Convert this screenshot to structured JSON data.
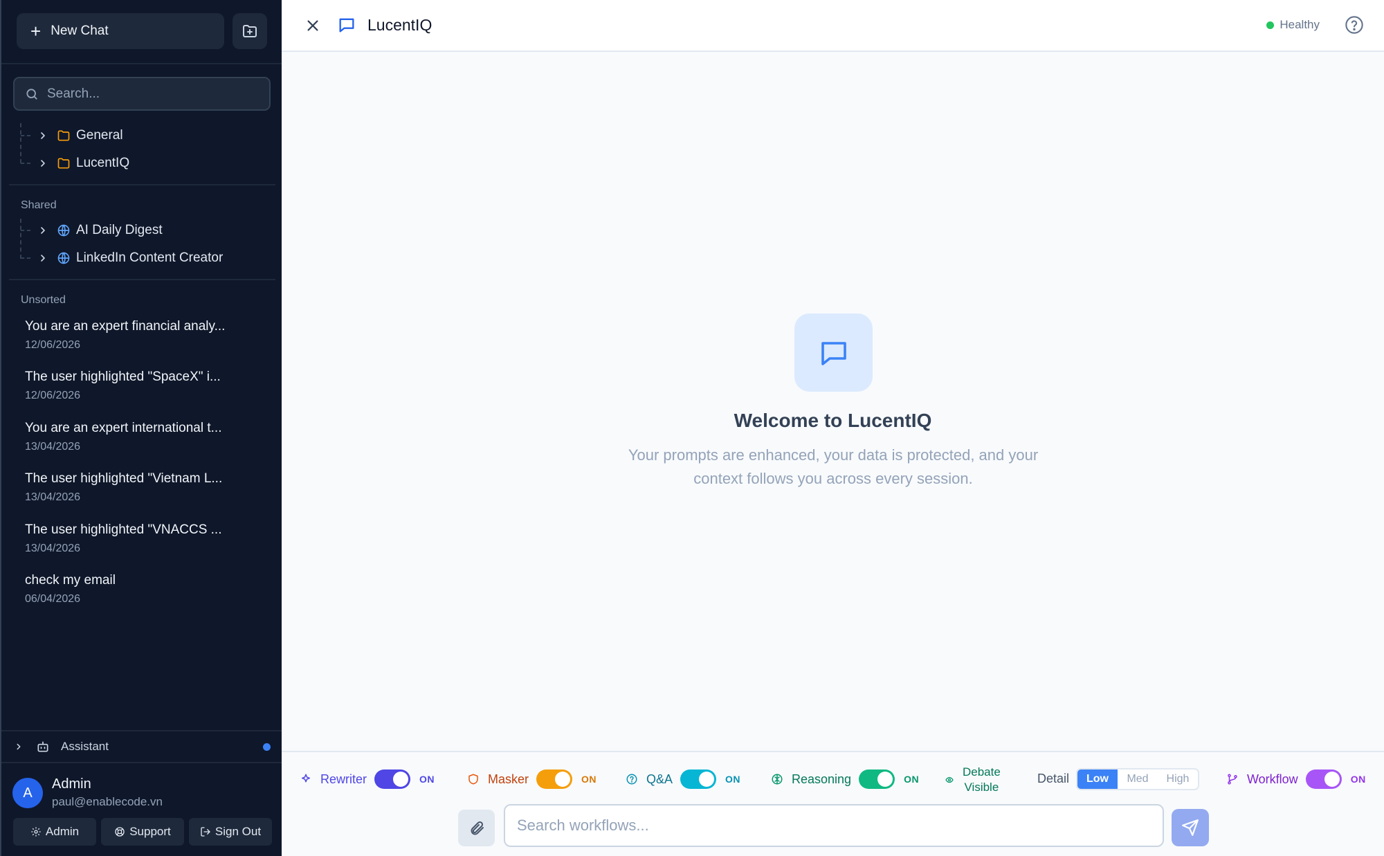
{
  "app": {
    "title": "LucentIQ"
  },
  "sidebar": {
    "new_chat_label": "New Chat",
    "new_chat_icon": "plus-icon",
    "new_folder_icon": "folder-plus-icon",
    "search": {
      "placeholder": "Search...",
      "value": ""
    },
    "folders": [
      {
        "label": "General",
        "icon": "folder-icon"
      },
      {
        "label": "LucentIQ",
        "icon": "folder-icon"
      }
    ],
    "shared_label": "Shared",
    "shared": [
      {
        "label": "AI Daily Digest",
        "icon": "globe-icon"
      },
      {
        "label": "LinkedIn Content Creator",
        "icon": "globe-icon"
      }
    ],
    "unsorted_label": "Unsorted",
    "chats": [
      {
        "title": "You are an expert financial analy...",
        "date": "12/06/2026"
      },
      {
        "title": "The user highlighted \"SpaceX\" i...",
        "date": "12/06/2026"
      },
      {
        "title": "You are an expert international t...",
        "date": "13/04/2026"
      },
      {
        "title": "The user highlighted \"Vietnam L...",
        "date": "13/04/2026"
      },
      {
        "title": "The user highlighted \"VNACCS ...",
        "date": "13/04/2026"
      },
      {
        "title": "check my email",
        "date": "06/04/2026"
      }
    ],
    "assistant_label": "Assistant",
    "user": {
      "initial": "A",
      "name": "Admin",
      "email": "paul@enablecode.vn"
    },
    "footer": {
      "admin": "Admin",
      "support": "Support",
      "signout": "Sign Out"
    }
  },
  "header": {
    "title": "LucentIQ",
    "status": "Healthy",
    "status_color": "#22c55e"
  },
  "welcome": {
    "title": "Welcome to LucentIQ",
    "subtitle": "Your prompts are enhanced, your data is protected, and your context follows you across every session."
  },
  "controls": {
    "rewriter": {
      "label": "Rewriter",
      "state": "ON",
      "color": "#4f46e5"
    },
    "masker": {
      "label": "Masker",
      "state": "ON",
      "color": "#f59e0b"
    },
    "qa": {
      "label": "Q&A",
      "state": "ON",
      "color": "#06b6d4"
    },
    "reasoning": {
      "label": "Reasoning",
      "state": "ON",
      "color": "#10b981"
    },
    "debate": {
      "line1": "Debate",
      "line2": "Visible"
    },
    "detail": {
      "label": "Detail",
      "options": [
        "Low",
        "Med",
        "High"
      ],
      "selected": "Low"
    },
    "workflow": {
      "label": "Workflow",
      "state": "ON",
      "color": "#a855f7"
    }
  },
  "composer": {
    "placeholder": "Search workflows...",
    "value": ""
  }
}
